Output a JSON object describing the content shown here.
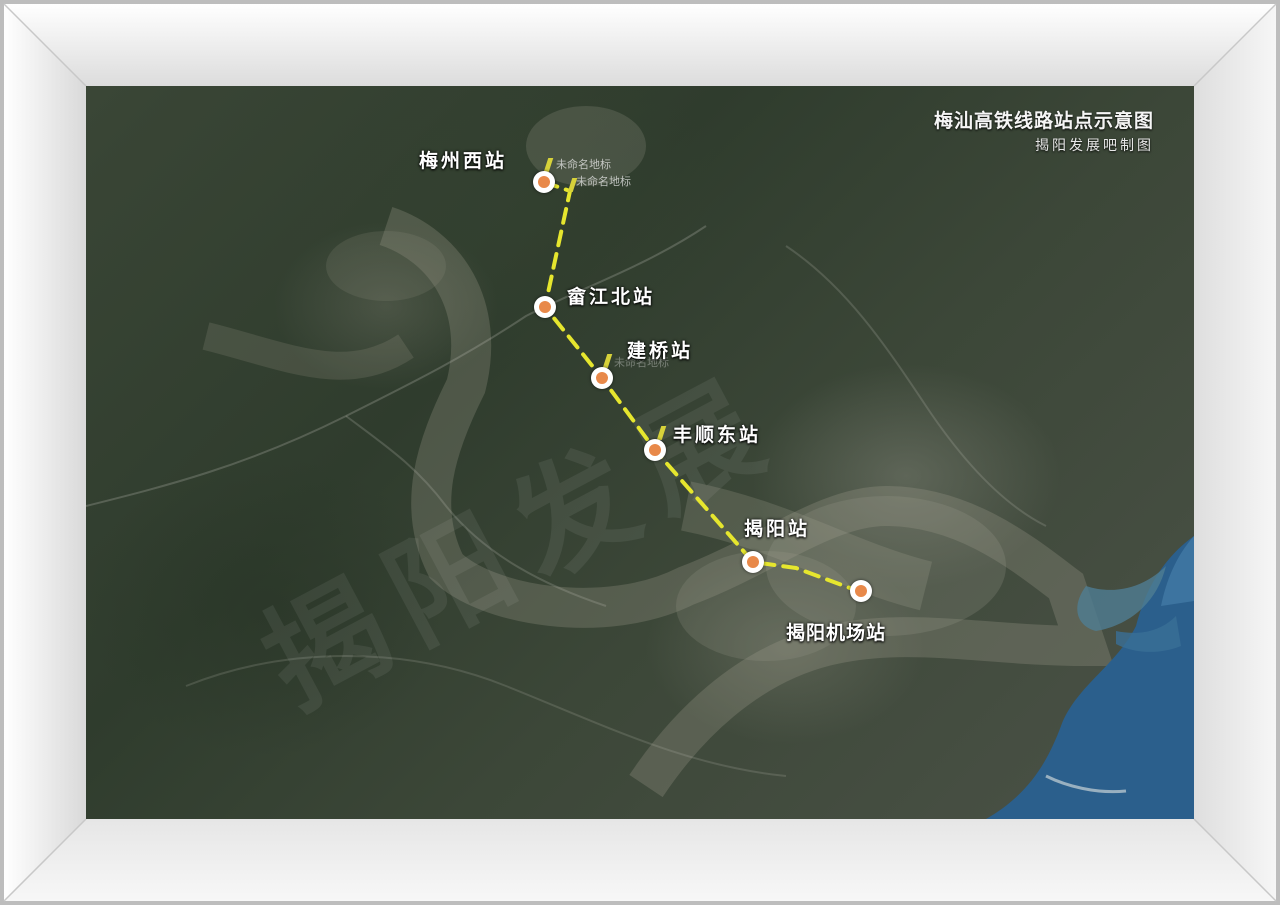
{
  "map": {
    "title": "梅汕高铁线路站点示意图",
    "credit": "揭阳发展吧制图",
    "route_color": "#e6e62e",
    "station_color": "#e8894a",
    "sea_color": "#2b5f8c"
  },
  "stations": [
    {
      "id": "meizhou-west",
      "name": "梅州西站"
    },
    {
      "id": "shejiang-north",
      "name": "畲江北站"
    },
    {
      "id": "jianqiao",
      "name": "建桥站"
    },
    {
      "id": "fengshun-east",
      "name": "丰顺东站"
    },
    {
      "id": "jieyang",
      "name": "揭阳站"
    },
    {
      "id": "jieyang-airport",
      "name": "揭阳机场站"
    }
  ],
  "unnamed_markers": {
    "note1": "未命名地标",
    "note2": "未命名地标",
    "note3": "未命名地标"
  },
  "watermark": "揭阳发展"
}
